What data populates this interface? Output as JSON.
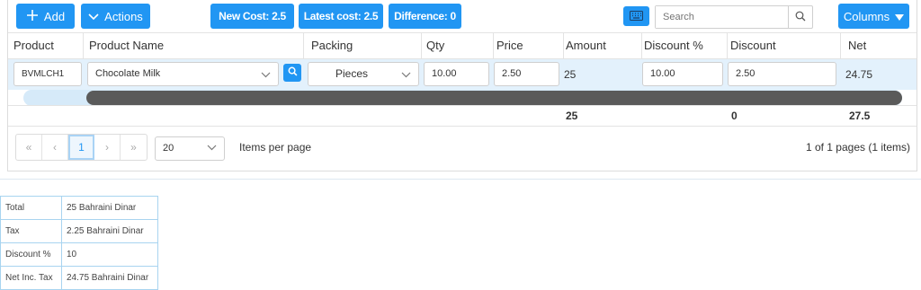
{
  "toolbar": {
    "add_label": "Add",
    "actions_label": "Actions",
    "new_cost": "New Cost: 2.5",
    "latest_cost": "Latest cost: 2.5",
    "difference": "Difference: 0",
    "search_placeholder": "Search",
    "columns_label": "Columns"
  },
  "columns": [
    "Product Code",
    "Product Name",
    "Packing",
    "Qty",
    "Price",
    "Amount",
    "Discount %",
    "Discount",
    "Net"
  ],
  "row": {
    "product_code": "BVMLCH1",
    "product_name": "Chocolate Milk",
    "packing": "Pieces",
    "qty": "10.00",
    "price": "2.50",
    "amount": "25",
    "discount_pct": "10.00",
    "discount": "2.50",
    "net": "24.75"
  },
  "totals": {
    "amount": "25",
    "discount": "0",
    "net": "27.5"
  },
  "pager": {
    "first": "«",
    "prev": "‹",
    "current": "1",
    "next": "›",
    "last": "»",
    "page_size": "20",
    "items_per_page": "Items per page",
    "info": "1 of 1 pages (1 items)"
  },
  "summary": [
    {
      "label": "Total",
      "value": "25 Bahraini Dinar"
    },
    {
      "label": "Tax",
      "value": "2.25 Bahraini Dinar"
    },
    {
      "label": "Discount %",
      "value": "10"
    },
    {
      "label": "Net Inc. Tax",
      "value": "24.75 Bahraini Dinar"
    }
  ],
  "colors": {
    "accent": "#2196f3",
    "row_highlight": "#e3f1fc",
    "scroll_thumb": "#5a5a5a"
  },
  "icons": [
    "plus-icon",
    "chevron-down-icon",
    "keyboard-icon",
    "search-icon",
    "caret-down-icon"
  ]
}
